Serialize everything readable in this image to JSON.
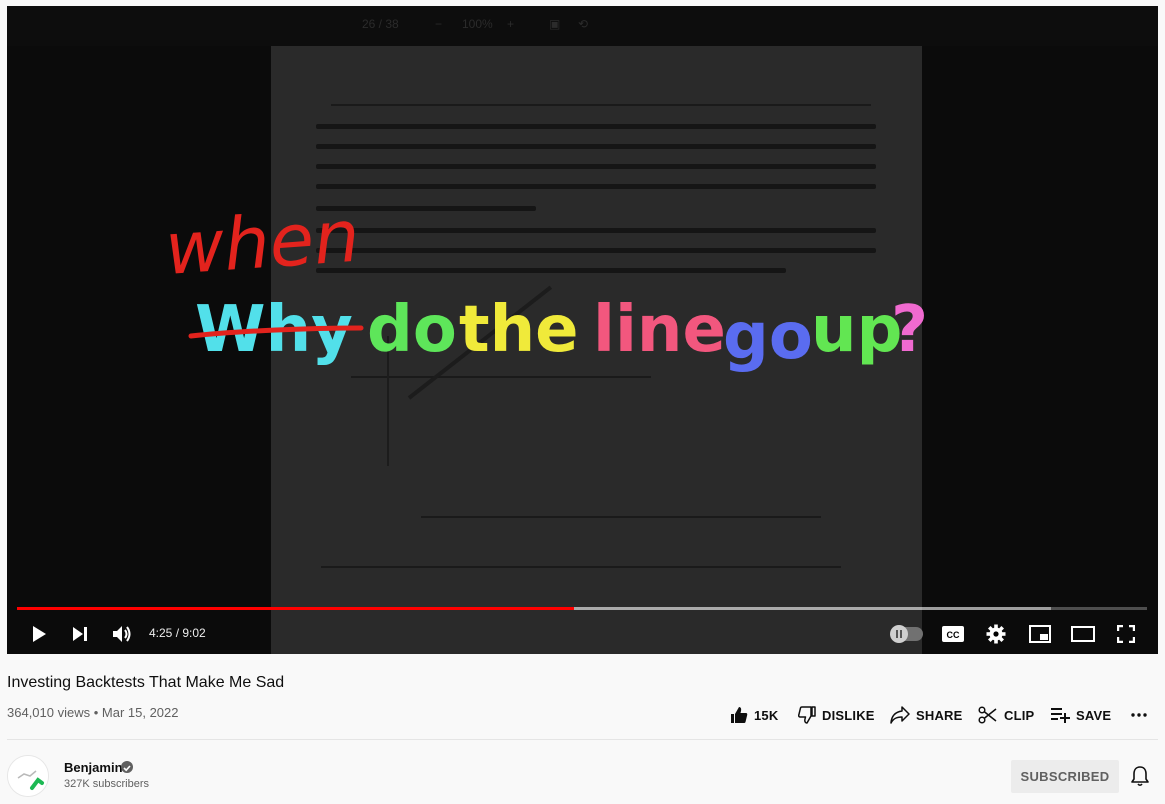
{
  "player": {
    "slide_overlay": {
      "correction_word": "when",
      "struck_word": "Why",
      "words": [
        "do",
        "the",
        "line",
        "go",
        "up",
        "?"
      ],
      "word_colors": {
        "correction": "#e3231d",
        "struck": "#52e0ea",
        "do": "#5ee65a",
        "the": "#f0ea3a",
        "line": "#f2577e",
        "go": "#5a6cf0",
        "up": "#62e652",
        "question": "#f06ad0"
      }
    },
    "document_toolbar": {
      "page_indicator": "26 / 38",
      "zoom": "100%"
    },
    "progress": {
      "played_fraction": 0.493,
      "buffered_fraction": 0.915,
      "accent": "#ff0000"
    },
    "time": "4:25 / 9:02",
    "icons": {
      "play": "play-icon",
      "next": "next-icon",
      "volume": "volume-icon",
      "autoplay": "autoplay-toggle",
      "captions": "cc-icon",
      "settings": "gear-icon",
      "miniplayer": "miniplayer-icon",
      "theater": "theater-icon",
      "fullscreen": "fullscreen-icon"
    }
  },
  "video": {
    "title": "Investing Backtests That Make Me Sad",
    "meta": "364,010 views • Mar 15, 2022"
  },
  "actions": {
    "like_count": "15K",
    "dislike_label": "DISLIKE",
    "share_label": "SHARE",
    "clip_label": "CLIP",
    "save_label": "SAVE"
  },
  "channel": {
    "name": "Benjamin",
    "subscribers": "327K subscribers",
    "subscribe_label": "SUBSCRIBED"
  }
}
